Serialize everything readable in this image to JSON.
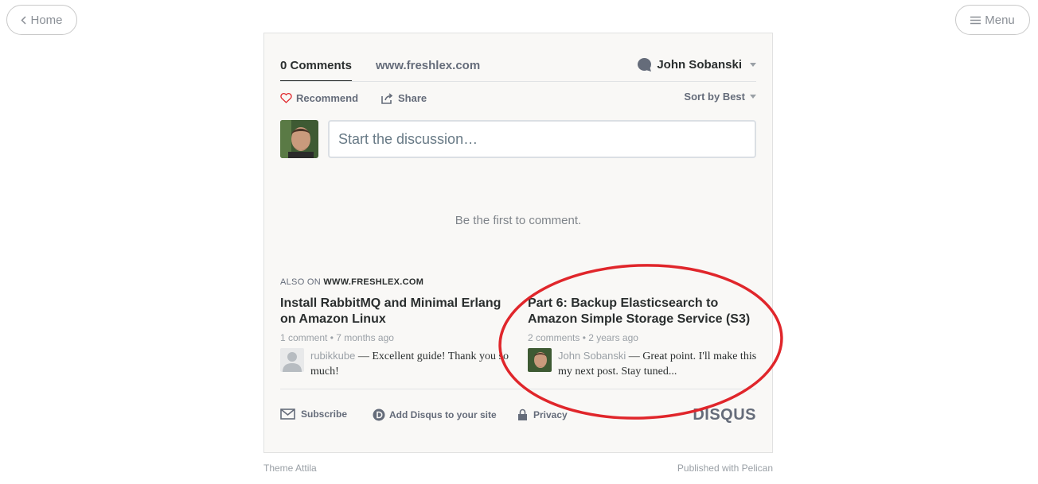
{
  "nav": {
    "home_label": "Home",
    "menu_label": "Menu"
  },
  "disqus": {
    "tab_comments": "0 Comments",
    "tab_site": "www.freshlex.com",
    "user_name": "John Sobanski",
    "recommend_label": "Recommend",
    "share_label": "Share",
    "sort_label": "Sort by Best",
    "input_placeholder": "Start the discussion…",
    "empty_message": "Be the first to comment.",
    "also_on_prefix": "ALSO ON",
    "also_on_site": "WWW.FRESHLEX.COM",
    "recommendations": [
      {
        "title": "Install RabbitMQ and Minimal Erlang on Amazon Linux",
        "meta": "1 comment • 7 months ago",
        "author": "rubikkube",
        "excerpt": " — Excellent guide! Thank you so much!"
      },
      {
        "title": "Part 6: Backup Elasticsearch to Amazon Simple Storage Service (S3)",
        "meta": "2 comments • 2 years ago",
        "author": "John Sobanski",
        "excerpt": " — Great point. I'll make this my next post. Stay tuned..."
      }
    ],
    "footer": {
      "subscribe_label": "Subscribe",
      "add_disqus_label": "Add Disqus to your site",
      "privacy_label": "Privacy",
      "logo_text": "DISQUS"
    }
  },
  "page_footer": {
    "theme_credit": "Theme Attila",
    "published_credit": "Published with Pelican"
  },
  "colors": {
    "annotation": "#e0262b",
    "recommend_heart": "#e0262b",
    "text_dark": "#2a2e2e",
    "text_muted": "#656c7a"
  }
}
